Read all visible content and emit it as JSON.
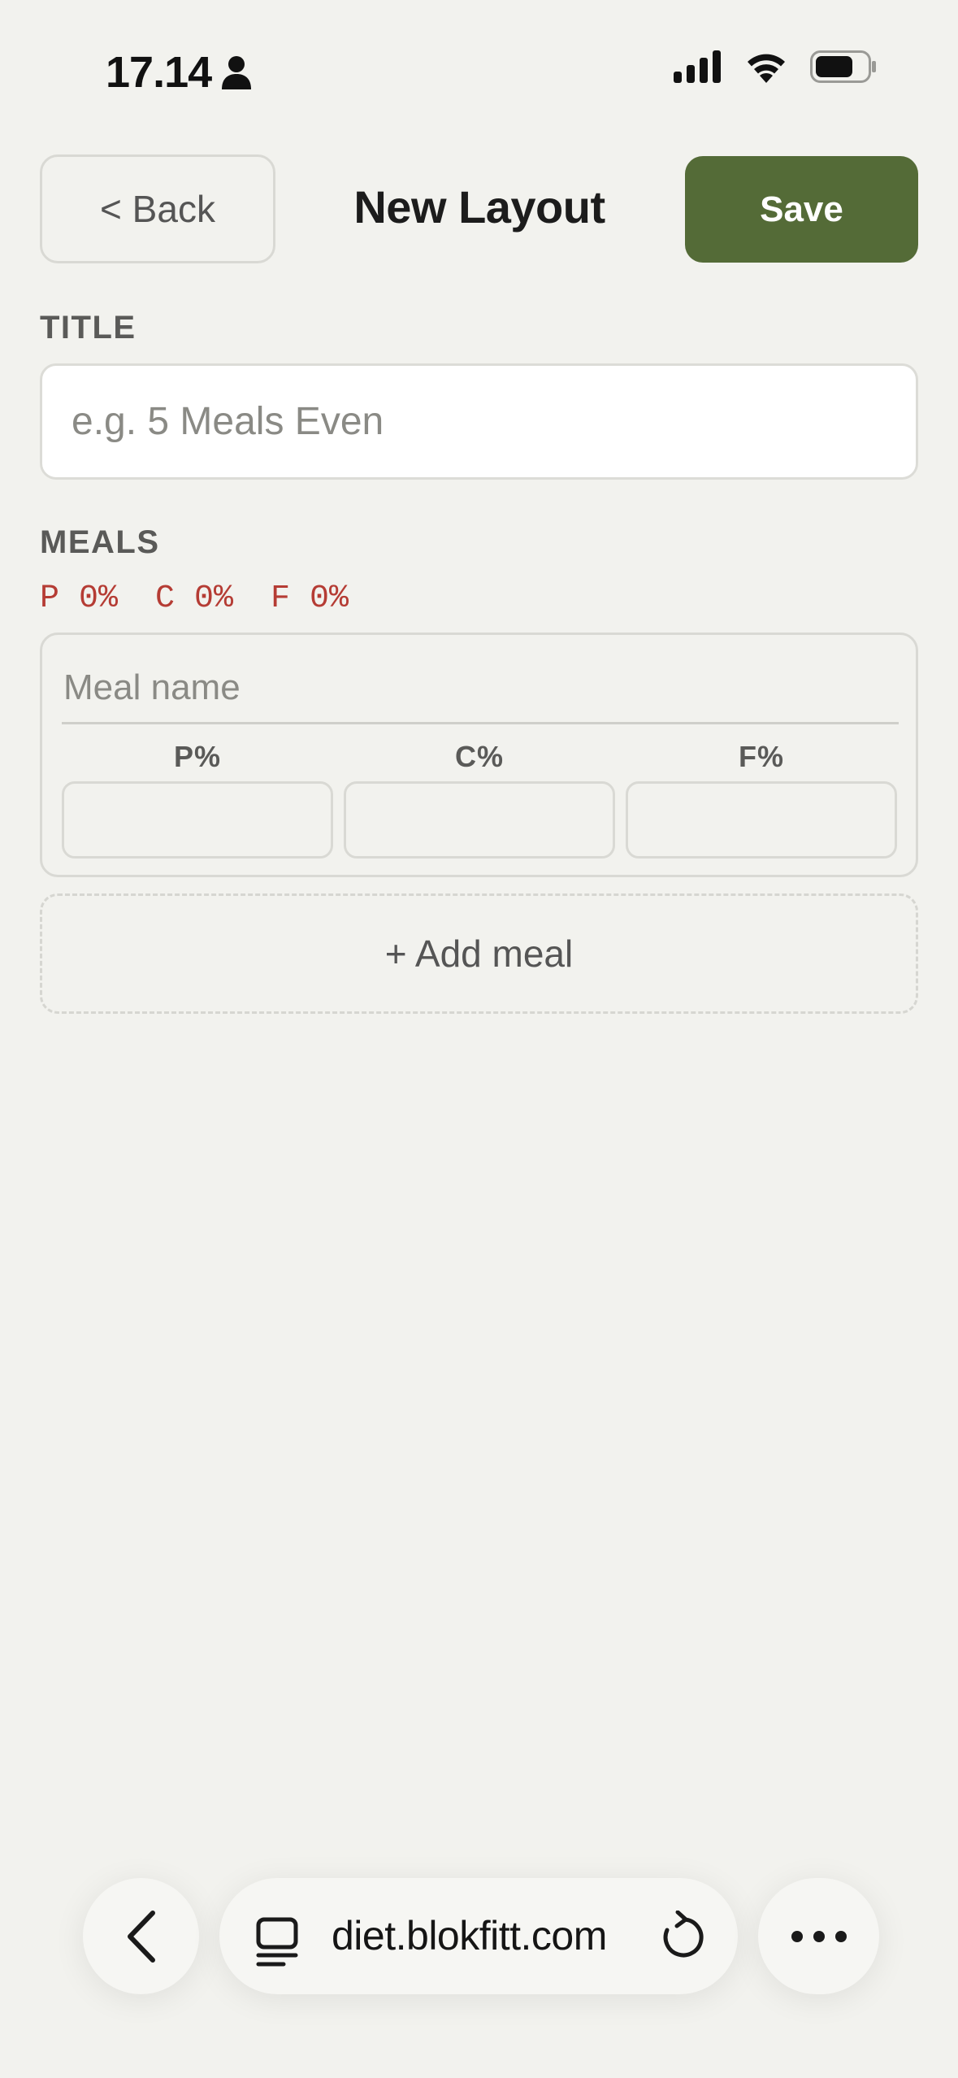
{
  "status_bar": {
    "time": "17.14",
    "icons": [
      "person-icon",
      "signal-icon",
      "wifi-icon",
      "battery-icon"
    ]
  },
  "header": {
    "back_label": "< Back",
    "title": "New Layout",
    "save_label": "Save"
  },
  "title_section": {
    "label": "TITLE",
    "value": "",
    "placeholder": "e.g. 5 Meals Even"
  },
  "meals_section": {
    "label": "MEALS",
    "macro_summary": {
      "protein": "P 0%",
      "carbs": "C 0%",
      "fat": "F 0%"
    },
    "meals": [
      {
        "name_value": "",
        "name_placeholder": "Meal name",
        "p_label": "P%",
        "c_label": "C%",
        "f_label": "F%",
        "p_value": "",
        "c_value": "",
        "f_value": ""
      }
    ],
    "add_meal_label": "+ Add meal"
  },
  "browser": {
    "url": "diet.blokfitt.com",
    "icons": [
      "chevron-left-icon",
      "tabs-icon",
      "reload-icon",
      "more-icon"
    ]
  },
  "colors": {
    "background": "#f2f2ee",
    "accent": "#546b37",
    "macro_warning": "#b53c34"
  }
}
